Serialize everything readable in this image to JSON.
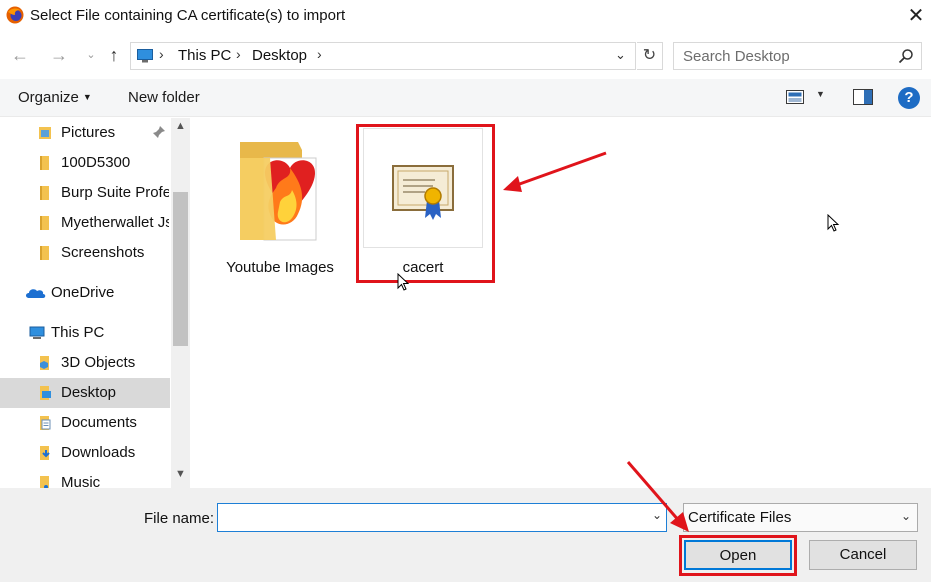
{
  "window": {
    "title": "Select File containing CA certificate(s) to import",
    "close_glyph": "✕"
  },
  "address": {
    "breadcrumbs": [
      "This PC",
      "Desktop"
    ],
    "search_placeholder": "Search Desktop"
  },
  "toolbar": {
    "organize_label": "Organize",
    "new_folder_label": "New folder",
    "help_label": "?"
  },
  "sidebar": {
    "items": [
      {
        "label": "Pictures",
        "icon": "pictures-folder-icon",
        "pinned": true
      },
      {
        "label": "100D5300",
        "icon": "folder-icon"
      },
      {
        "label": "Burp Suite Profes",
        "icon": "folder-icon"
      },
      {
        "label": "Myetherwallet Js",
        "icon": "folder-icon"
      },
      {
        "label": "Screenshots",
        "icon": "folder-icon"
      },
      {
        "label": "OneDrive",
        "icon": "onedrive-icon"
      },
      {
        "label": "This PC",
        "icon": "this-pc-icon"
      },
      {
        "label": "3D Objects",
        "icon": "3d-objects-icon"
      },
      {
        "label": "Desktop",
        "icon": "desktop-icon",
        "selected": true
      },
      {
        "label": "Documents",
        "icon": "documents-icon"
      },
      {
        "label": "Downloads",
        "icon": "downloads-icon"
      },
      {
        "label": "Music",
        "icon": "music-icon"
      }
    ]
  },
  "files": [
    {
      "name": "Youtube Images",
      "icon": "folder-with-images-icon"
    },
    {
      "name": "cacert",
      "icon": "certificate-icon"
    }
  ],
  "footer": {
    "file_name_label": "File name:",
    "file_name_value": "",
    "file_type_selected": "Certificate Files",
    "open_label": "Open",
    "cancel_label": "Cancel"
  },
  "colors": {
    "accent": "#0078d7",
    "annotation_red": "#e0141b",
    "selected_bg": "#d9d9d9",
    "toolbar_bg": "#f5f6f7",
    "footer_bg": "#f0f0f0"
  }
}
